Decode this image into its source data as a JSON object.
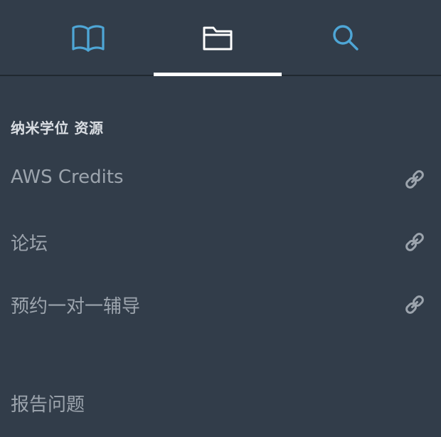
{
  "tabs": [
    {
      "icon": "book-icon",
      "active": false,
      "color": "#4ea6d6"
    },
    {
      "icon": "folder-icon",
      "active": true,
      "color": "#ffffff"
    },
    {
      "icon": "search-icon",
      "active": false,
      "color": "#4ea6d6"
    }
  ],
  "resources": {
    "title": "纳米学位 资源",
    "items": [
      {
        "label": "AWS Credits",
        "icon": "link-icon"
      },
      {
        "label": "论坛",
        "icon": "link-icon"
      },
      {
        "label": "预约一对一辅导",
        "icon": "link-icon"
      }
    ]
  },
  "footer": {
    "report_label": "报告问题"
  },
  "colors": {
    "background": "#323d4a",
    "accent": "#4ea6d6",
    "text_muted": "#9ca4ad",
    "heading": "#d9dde2"
  }
}
